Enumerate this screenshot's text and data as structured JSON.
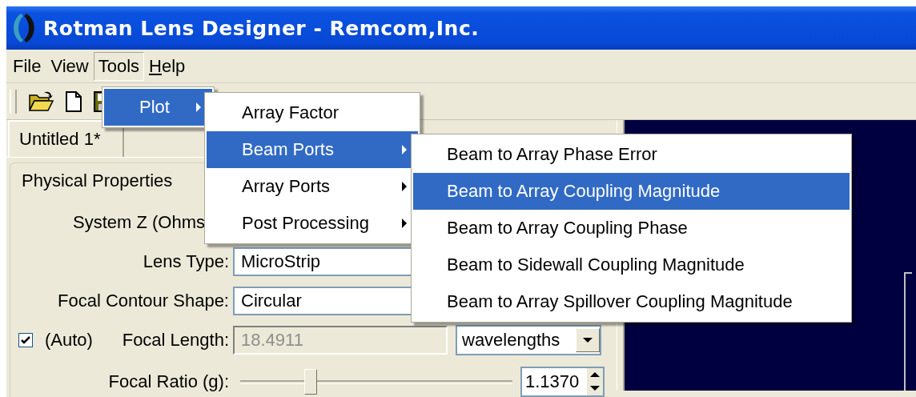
{
  "window": {
    "title": "Rotman Lens Designer - Remcom,Inc."
  },
  "menu_bar": [
    {
      "label": "File",
      "selected": false,
      "mnemonic": false
    },
    {
      "label": "View",
      "selected": false,
      "mnemonic": false
    },
    {
      "label": "Tools",
      "selected": true,
      "mnemonic": false
    },
    {
      "label": "Help",
      "selected": false,
      "mnemonic": true
    }
  ],
  "menus": [
    {
      "items": [
        {
          "label": "Plot",
          "selected": true,
          "submenu": true
        }
      ]
    },
    {
      "items": [
        {
          "label": "Array Factor",
          "selected": false,
          "submenu": false
        },
        {
          "label": "Beam Ports",
          "selected": true,
          "submenu": true
        },
        {
          "label": "Array Ports",
          "selected": false,
          "submenu": true
        },
        {
          "label": "Post Processing",
          "selected": false,
          "submenu": true
        }
      ]
    },
    {
      "items": [
        {
          "label": "Beam to Array Phase Error",
          "selected": false,
          "submenu": false
        },
        {
          "label": "Beam to Array Coupling Magnitude",
          "selected": true,
          "submenu": false
        },
        {
          "label": "Beam to Array Coupling Phase",
          "selected": false,
          "submenu": false
        },
        {
          "label": "Beam to Sidewall Coupling Magnitude",
          "selected": false,
          "submenu": false
        },
        {
          "label": "Beam to Array Spillover Coupling Magnitude",
          "selected": false,
          "submenu": false
        }
      ]
    }
  ],
  "tabs": [
    {
      "label": "Untitled 1*",
      "selected": true
    }
  ],
  "panel": {
    "title": "Physical Properties",
    "rows": [
      {
        "kind": "label",
        "label": "System Z (Ohms"
      },
      {
        "kind": "combo",
        "label": "Lens Type:",
        "value": "MicroStrip"
      },
      {
        "kind": "combo",
        "label": "Focal Contour Shape:",
        "value": "Circular"
      },
      {
        "kind": "auto",
        "checkbox_label": "(Auto)",
        "checked": true,
        "label": "Focal Length:",
        "value": "18.4911",
        "disabled": true,
        "unit": "wavelengths"
      },
      {
        "kind": "slider",
        "label": "Focal Ratio (g):",
        "level": 0.26,
        "value": "1.1370"
      }
    ]
  }
}
